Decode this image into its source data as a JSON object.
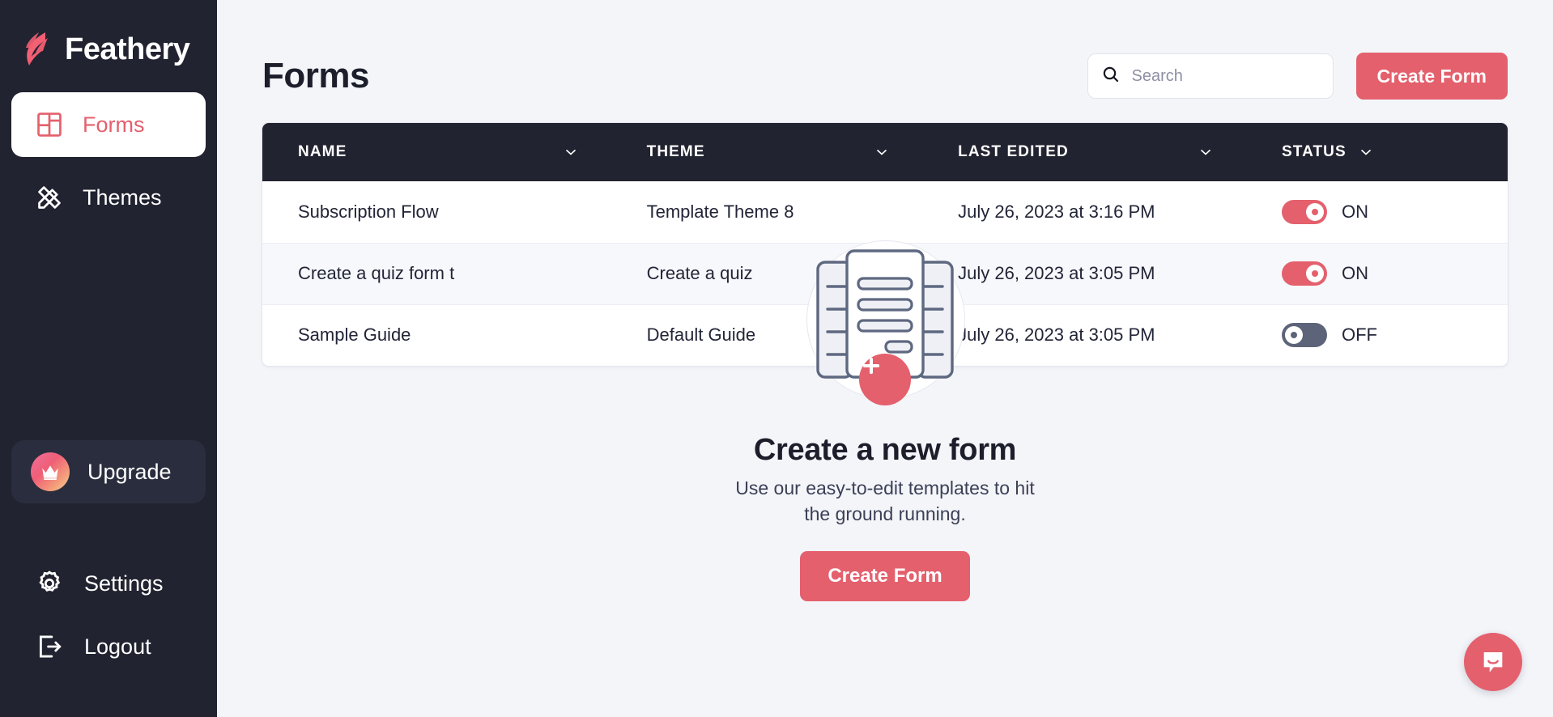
{
  "sidebar": {
    "brand": {
      "name": "Feathery",
      "logo_icon": "feathery-logo-icon"
    },
    "nav_items": [
      {
        "label": "Forms",
        "icon": "grid-layout-icon",
        "active": true
      },
      {
        "label": "Themes",
        "icon": "pencil-ruler-icon",
        "active": false
      }
    ],
    "upgrade": {
      "label": "Upgrade",
      "icon": "crown-icon"
    },
    "bottom_items": [
      {
        "label": "Settings",
        "icon": "gear-icon"
      },
      {
        "label": "Logout",
        "icon": "logout-arrow-icon"
      }
    ]
  },
  "header": {
    "title": "Forms",
    "search": {
      "placeholder": "Search",
      "value": "",
      "icon": "search-icon"
    },
    "create_button": "Create Form"
  },
  "table": {
    "columns": [
      {
        "label": "NAME",
        "sort_icon": "chevron-down-icon"
      },
      {
        "label": "THEME",
        "sort_icon": "chevron-down-icon"
      },
      {
        "label": "LAST EDITED",
        "sort_icon": "chevron-down-icon"
      },
      {
        "label": "STATUS",
        "sort_icon": "chevron-down-icon"
      }
    ],
    "rows": [
      {
        "name": "Subscription Flow",
        "theme": "Template Theme 8",
        "last_edited": "July 26, 2023 at 3:16 PM",
        "status": "ON",
        "status_on": true
      },
      {
        "name": "Create a quiz form t",
        "theme": "Create a quiz",
        "last_edited": "July 26, 2023 at 3:05 PM",
        "status": "ON",
        "status_on": true
      },
      {
        "name": "Sample Guide",
        "theme": "Default Guide",
        "last_edited": "July 26, 2023 at 3:05 PM",
        "status": "OFF",
        "status_on": false
      }
    ]
  },
  "empty_state": {
    "illustration_icon": "document-form-icon",
    "plus_icon": "plus-icon",
    "title": "Create a new form",
    "subtitle": "Use our easy-to-edit templates to hit the ground running.",
    "cta_label": "Create Form"
  },
  "chat": {
    "icon": "chat-smile-icon"
  },
  "colors": {
    "accent": "#e4606d",
    "sidebar_bg": "#212330",
    "page_bg": "#f4f5f9",
    "toggle_off": "#5d6479"
  }
}
